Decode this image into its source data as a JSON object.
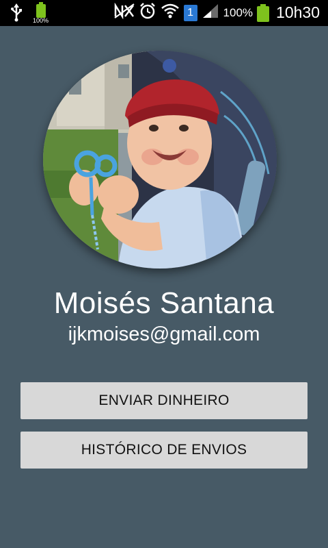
{
  "statusbar": {
    "battery_mini_label": "100%",
    "sim_slot": "1",
    "battery_percent": "100%",
    "time": "10h30"
  },
  "profile": {
    "name": "Moisés Santana",
    "email": "ijkmoises@gmail.com"
  },
  "actions": {
    "send_money_label": "ENVIAR DINHEIRO",
    "history_label": "HISTÓRICO DE ENVIOS"
  },
  "colors": {
    "background": "#475a66",
    "button": "#d8d8d8",
    "battery": "#7ec21d",
    "sim_badge": "#2a79d4"
  }
}
